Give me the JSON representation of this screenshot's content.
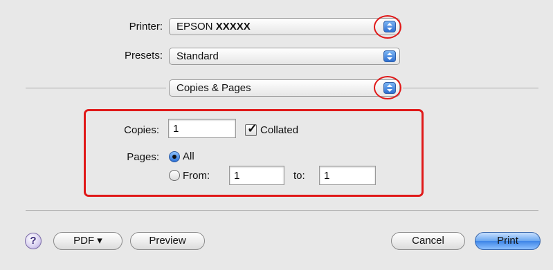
{
  "printer": {
    "label": "Printer:",
    "value_prefix": "EPSON",
    "value_model": "XXXXX"
  },
  "presets": {
    "label": "Presets:",
    "value": "Standard"
  },
  "panel": {
    "value": "Copies & Pages"
  },
  "copies": {
    "label": "Copies:",
    "value": "1",
    "collated_label": "Collated",
    "collated_checked": true
  },
  "pages": {
    "label": "Pages:",
    "all_label": "All",
    "all_selected": true,
    "from_label": "From:",
    "from_value": "1",
    "to_label": "to:",
    "to_value": "1"
  },
  "buttons": {
    "help": "?",
    "pdf": "PDF ▾",
    "preview": "Preview",
    "cancel": "Cancel",
    "print": "Print"
  },
  "colors": {
    "highlight": "#e01818",
    "accent": "#3e86e8",
    "background": "#e8e8e8"
  }
}
